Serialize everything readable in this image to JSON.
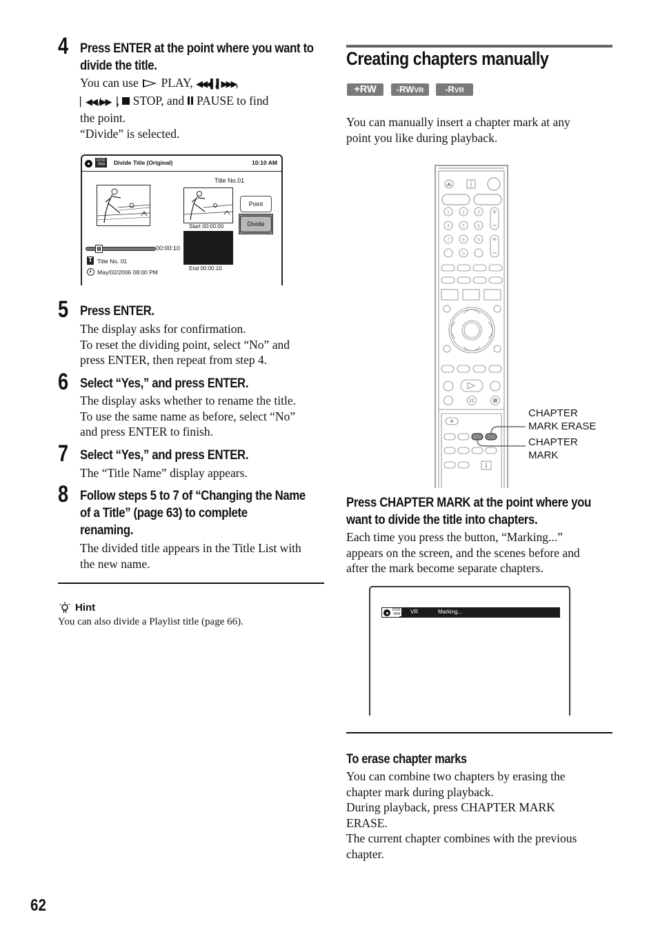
{
  "page_number": "62",
  "left_column": {
    "steps": [
      {
        "number": "4",
        "heading": "Press ENTER at the point where you want to divide the title.",
        "heading_lines": [
          "Press ENTER at the point where you want to",
          "divide the title."
        ],
        "body": {
          "line1_prefix": "You can use",
          "play_icon": "play-outline-icon",
          "play_label": "PLAY,",
          "scan_icons": "◀◀◀❚/❚▶▶▶",
          "skip_icons": "|◀◀ /▶▶|",
          "stop_label": "STOP, and",
          "pause_label": "PAUSE to find",
          "line3": "the point.",
          "line4": "“Divide” is selected."
        }
      },
      {
        "number": "5",
        "heading": "Press ENTER.",
        "body_lines": [
          "The display asks for confirmation.",
          "To reset the dividing point, select “No” and",
          "press ENTER, then repeat from step 4."
        ]
      },
      {
        "number": "6",
        "heading": "Select “Yes,” and press ENTER.",
        "body_lines": [
          "The display asks whether to rename the title.",
          "To use the same name as before, select “No”",
          "and press ENTER to finish."
        ]
      },
      {
        "number": "7",
        "heading": "Select “Yes,” and press ENTER.",
        "body_lines": [
          "The “Title Name” display appears."
        ]
      },
      {
        "number": "8",
        "heading_lines": [
          "Follow steps 5 to 7 of “Changing the Name",
          "of a Title” (page 63) to complete",
          "renaming."
        ],
        "body_lines": [
          "The divided title appears in the Title List with",
          "the new name."
        ]
      }
    ],
    "divide_screen": {
      "disc_badge_top": "DVD",
      "disc_badge_bottom": "-RW",
      "title": "Divide Title (Original)",
      "clock": "10:10 AM",
      "title_no_label": "Title No.01",
      "point_button": "Point",
      "divide_button": "Divide",
      "start_label": "Start  00:00:00",
      "end_label": "End   00:00:10",
      "slider_time": "00:00:10",
      "slider_position": 0.15,
      "title_number_text": "Title No. 01",
      "title_icon_letter": "T",
      "date_text": "May/02/2006  08:00  PM"
    },
    "hint": {
      "label": "Hint",
      "text": "You can also divide a Playlist title (page 66)."
    }
  },
  "right_column": {
    "section_title": "Creating chapters manually",
    "media_badges": [
      {
        "main": "+RW",
        "sub": ""
      },
      {
        "main": "-RW",
        "sub": "VR"
      },
      {
        "main": "-R",
        "sub": "VR"
      }
    ],
    "intro_lines": [
      "You can manually insert a chapter mark at any",
      "point you like during playback."
    ],
    "remote_labels": {
      "erase_line1": "CHAPTER",
      "erase_line2": "MARK ERASE",
      "mark_line1": "CHAPTER",
      "mark_line2": "MARK"
    },
    "remote_keypad": [
      "1",
      "2",
      "3",
      "4",
      "5",
      "6",
      "7",
      "8",
      "9",
      "0"
    ],
    "instruction_heading_lines": [
      "Press CHAPTER MARK at the point where you",
      "want to divide the title into chapters."
    ],
    "instruction_body_lines": [
      "Each time you press the button, “Marking...”",
      "appears on the screen, and the scenes before and",
      "after the mark become separate chapters."
    ],
    "marking_screen": {
      "disc_badge_top": "DVD",
      "disc_badge_bottom": "-RW",
      "mode": "VR",
      "status": "Marking..."
    },
    "erase_section": {
      "heading": "To erase chapter marks",
      "body_lines": [
        "You can combine two chapters by erasing the",
        "chapter mark during playback.",
        "During playback, press CHAPTER MARK",
        "ERASE.",
        "The current chapter combines with the previous",
        "chapter."
      ]
    }
  },
  "colors": {
    "badge_gray": "#7a7a7a",
    "highlight_button": "#b8b8b8",
    "chapter_buttons": "#8a8a8a",
    "remote_line": "#a0a0a0"
  }
}
